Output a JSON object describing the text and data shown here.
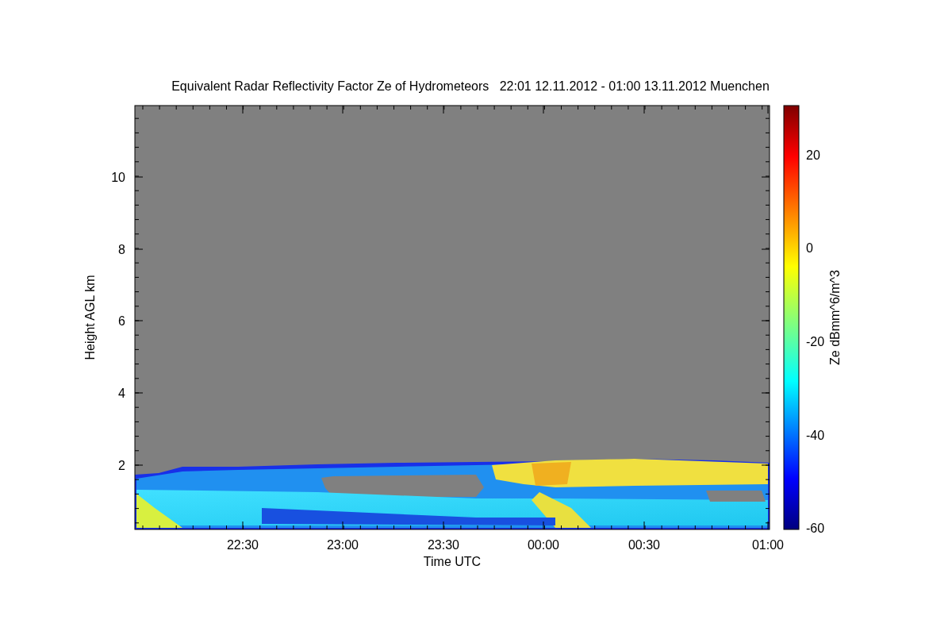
{
  "figure": {
    "title": "Equivalent Radar Reflectivity Factor Ze of Hydrometeors   22:01 12.11.2012 - 01:00 13.11.2012 Muenchen",
    "ylabel": "Height AGL km",
    "xlabel": "Time UTC",
    "yticks": [
      "10",
      "8",
      "6",
      "4",
      "2"
    ],
    "xticks": [
      "22:30",
      "23:00",
      "23:30",
      "00:00",
      "00:30",
      "01:00"
    ],
    "colorbar": {
      "label": "Ze dBmm^6/m^3",
      "ticks": [
        "20",
        "0",
        "-20",
        "-40",
        "-60"
      ]
    }
  }
}
